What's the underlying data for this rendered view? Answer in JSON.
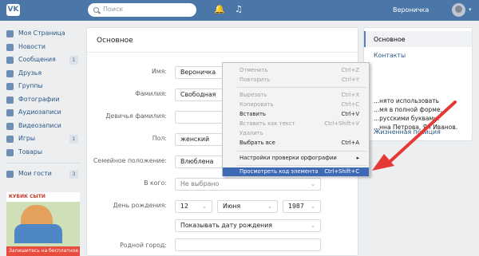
{
  "header": {
    "logo": "VK",
    "search_placeholder": "Поиск",
    "bell_icon": "bell-icon",
    "music_icon": "music-icon",
    "user_name": "Вероничка"
  },
  "sidebar": {
    "items": [
      {
        "label": "Моя Страница",
        "icon": "home-icon",
        "count": ""
      },
      {
        "label": "Новости",
        "icon": "news-icon",
        "count": ""
      },
      {
        "label": "Сообщения",
        "icon": "message-icon",
        "count": "1"
      },
      {
        "label": "Друзья",
        "icon": "friends-icon",
        "count": ""
      },
      {
        "label": "Группы",
        "icon": "groups-icon",
        "count": ""
      },
      {
        "label": "Фотографии",
        "icon": "camera-icon",
        "count": ""
      },
      {
        "label": "Аудиозаписи",
        "icon": "audio-icon",
        "count": ""
      },
      {
        "label": "Видеозаписи",
        "icon": "video-icon",
        "count": ""
      },
      {
        "label": "Игры",
        "icon": "games-icon",
        "count": "1"
      },
      {
        "label": "Товары",
        "icon": "bag-icon",
        "count": ""
      }
    ],
    "guests": {
      "label": "Мои гости",
      "icon": "guests-icon",
      "count": "3"
    },
    "ad": {
      "title": "КУБИК СЫТИ",
      "caption": "Запишитесь на бесплатное"
    }
  },
  "main": {
    "title": "Основное",
    "fields": {
      "name": {
        "label": "Имя:",
        "value": "Вероничка"
      },
      "surname": {
        "label": "Фамилия:",
        "value": "Свободная"
      },
      "maiden": {
        "label": "Девичья фамилия:",
        "value": ""
      },
      "gender": {
        "label": "Пол:",
        "value": "женский"
      },
      "family": {
        "label": "Семейное положение:",
        "value": "Влюблена"
      },
      "in_whom": {
        "label": "В кого:",
        "value": "Не выбрано"
      },
      "birthday": {
        "label": "День рождения:",
        "day": "12",
        "month": "Июня",
        "year": "1987",
        "show": "Показывать дату рождения"
      },
      "hometown": {
        "label": "Родной город:",
        "value": ""
      }
    }
  },
  "right": {
    "tabs": [
      "Основное",
      "Контакты"
    ],
    "tip": [
      "...нято использовать",
      "...мя в полной форме,",
      "...русскими буквами.",
      "",
      "...нна Петрова, Ян Иванов."
    ],
    "life": "Жизненная позиция"
  },
  "context_menu": {
    "items": [
      {
        "label": "Отменить",
        "key": "Ctrl+Z",
        "disabled": true
      },
      {
        "label": "Повторить",
        "key": "Ctrl+Y",
        "disabled": true
      },
      {
        "label": "Вырезать",
        "key": "Ctrl+X",
        "disabled": true
      },
      {
        "label": "Копировать",
        "key": "Ctrl+C",
        "disabled": true
      },
      {
        "label": "Вставить",
        "key": "Ctrl+V",
        "disabled": false
      },
      {
        "label": "Вставить как текст",
        "key": "Ctrl+Shift+V",
        "disabled": true
      },
      {
        "label": "Удалить",
        "key": "",
        "disabled": true
      },
      {
        "label": "Выбрать все",
        "key": "Ctrl+A",
        "disabled": false
      },
      {
        "label": "Настройки проверки орфографии",
        "key": "▸",
        "disabled": false
      },
      {
        "label": "Просмотреть код элемента",
        "key": "Ctrl+Shift+C",
        "disabled": false
      }
    ]
  },
  "colors": {
    "header": "#4a76a8",
    "highlight": "#3e6ab5",
    "arrow": "#e53935"
  }
}
